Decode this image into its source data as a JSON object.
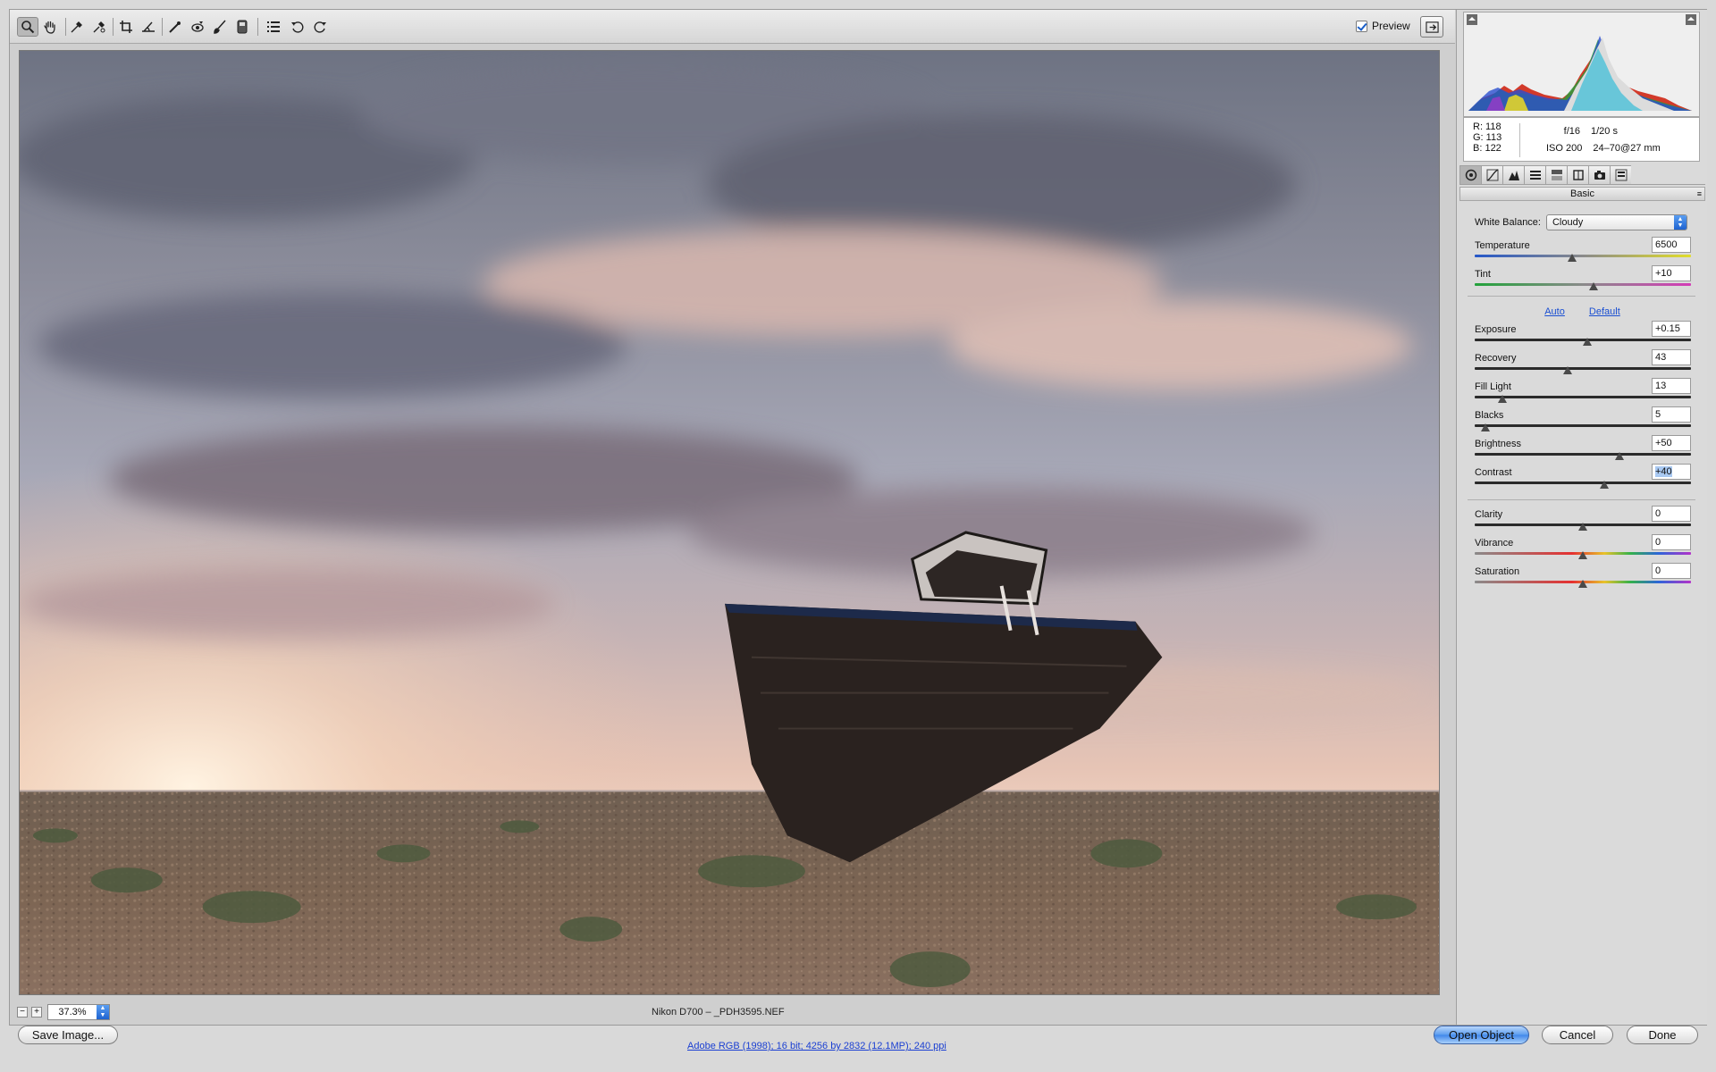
{
  "toolbar": {
    "tools": [
      {
        "name": "zoom-tool",
        "icon": "magnifier-icon",
        "active": true
      },
      {
        "name": "hand-tool",
        "icon": "hand-icon"
      },
      {
        "name": "white-balance-tool",
        "icon": "eyedropper-icon"
      },
      {
        "name": "color-sampler-tool",
        "icon": "sampler-icon"
      },
      {
        "name": "crop-tool",
        "icon": "crop-icon"
      },
      {
        "name": "straighten-tool",
        "icon": "straighten-icon"
      },
      {
        "name": "spot-removal-tool",
        "icon": "spot-removal-icon"
      },
      {
        "name": "red-eye-tool",
        "icon": "red-eye-icon"
      },
      {
        "name": "adjustment-brush-tool",
        "icon": "brush-icon"
      },
      {
        "name": "graduated-filter-tool",
        "icon": "gradient-icon"
      },
      {
        "name": "preferences-tool",
        "icon": "list-icon"
      },
      {
        "name": "rotate-ccw-tool",
        "icon": "rotate-left-icon"
      },
      {
        "name": "rotate-cw-tool",
        "icon": "rotate-right-icon"
      }
    ],
    "preview_label": "Preview",
    "preview_checked": true
  },
  "status": {
    "zoom": "37.3%",
    "file": "Nikon D700  –  _PDH3595.NEF"
  },
  "readout": {
    "r": "R:  118",
    "g": "G:  113",
    "b": "B:  122",
    "aperture": "f/16",
    "shutter": "1/20 s",
    "iso": "ISO 200",
    "lens": "24–70@27 mm"
  },
  "panel": {
    "section_title": "Basic",
    "white_balance_label": "White Balance:",
    "white_balance_value": "Cloudy",
    "auto_label": "Auto",
    "default_label": "Default",
    "sliders": [
      {
        "id": "temperature",
        "label": "Temperature",
        "value": "6500",
        "position": 0.45
      },
      {
        "id": "tint",
        "label": "Tint",
        "value": "+10",
        "position": 0.55
      },
      {
        "id": "exposure",
        "label": "Exposure",
        "value": "+0.15",
        "position": 0.52
      },
      {
        "id": "recovery",
        "label": "Recovery",
        "value": "43",
        "position": 0.43
      },
      {
        "id": "fill-light",
        "label": "Fill Light",
        "value": "13",
        "position": 0.13
      },
      {
        "id": "blacks",
        "label": "Blacks",
        "value": "5",
        "position": 0.05
      },
      {
        "id": "brightness",
        "label": "Brightness",
        "value": "+50",
        "position": 0.67
      },
      {
        "id": "contrast",
        "label": "Contrast",
        "value": "+40",
        "position": 0.6,
        "selected": true
      },
      {
        "id": "clarity",
        "label": "Clarity",
        "value": "0",
        "position": 0.5
      },
      {
        "id": "vibrance",
        "label": "Vibrance",
        "value": "0",
        "position": 0.5
      },
      {
        "id": "saturation",
        "label": "Saturation",
        "value": "0",
        "position": 0.5
      }
    ]
  },
  "bottom": {
    "save_label": "Save Image...",
    "workflow_label": "Adobe RGB (1998); 16 bit; 4256 by 2832 (12.1MP); 240 ppi",
    "open_label": "Open Object",
    "cancel_label": "Cancel",
    "done_label": "Done"
  }
}
